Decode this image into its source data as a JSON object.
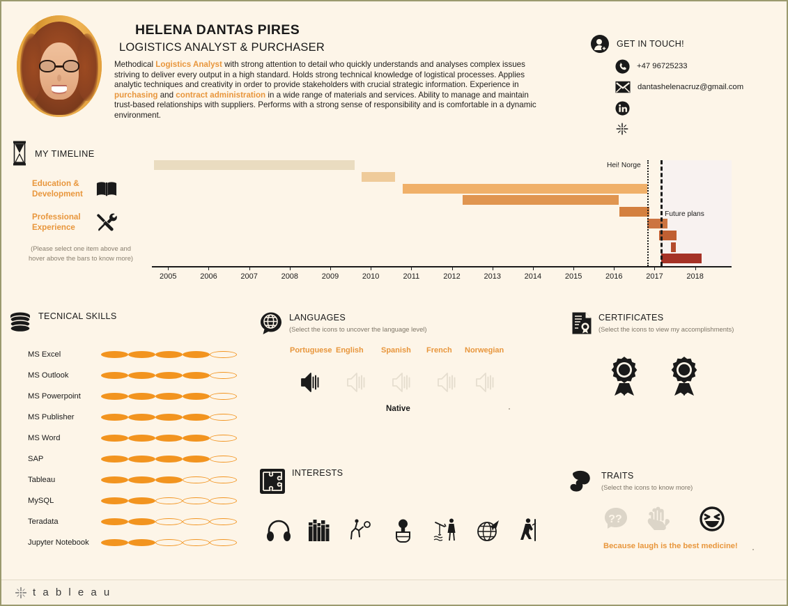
{
  "profile": {
    "name": "HELENA DANTAS PIRES",
    "role": "LOGISTICS ANALYST & PURCHASER",
    "avatar_icon": "profile-photo",
    "summary_parts": [
      {
        "t": "Methodical ",
        "hl": false
      },
      {
        "t": "Logistics Analyst",
        "hl": true
      },
      {
        "t": " with strong attention to detail who quickly understands and analyses complex issues striving to deliver every output in a high standard. Holds strong technical knowledge of logistical processes. Applies analytic techniques and creativity in order to provide stakeholders with crucial strategic information. Experience in ",
        "hl": false
      },
      {
        "t": "purchasing",
        "hl": true
      },
      {
        "t": " and ",
        "hl": false
      },
      {
        "t": "contract administration",
        "hl": true
      },
      {
        "t": " in a wide range of materials and services. Ability to manage and maintain trust-based relationships with suppliers. Performs with a strong sense of responsibility and is comfortable in a dynamic environment.",
        "hl": false
      }
    ]
  },
  "contact": {
    "title": "GET IN TOUCH!",
    "header_icon": "user-add-icon",
    "rows": [
      {
        "icon": "phone-icon",
        "text": "+47 96725233"
      },
      {
        "icon": "envelope-icon",
        "text": "dantashelenacruz@gmail.com"
      },
      {
        "icon": "linkedin-icon",
        "text": ""
      },
      {
        "icon": "tableau-icon",
        "text": ""
      }
    ]
  },
  "timeline": {
    "title": "MY TIMELINE",
    "header_icon": "hourglass-icon",
    "options": [
      {
        "label": "Education & Development",
        "icon": "open-book-icon"
      },
      {
        "label": "Professional Experience",
        "icon": "tools-icon"
      }
    ],
    "hint": "(Please select one item above and hover above the bars to know more)"
  },
  "chart_data": {
    "type": "bar",
    "chart_style": "gantt",
    "title": "My Timeline",
    "xlabel": "",
    "ylabel": "",
    "xlim": [
      2004.6,
      2018.9
    ],
    "x_ticks": [
      2005,
      2006,
      2007,
      2008,
      2009,
      2010,
      2011,
      2012,
      2013,
      2014,
      2015,
      2016,
      2017,
      2018
    ],
    "grid": false,
    "legend": "none",
    "bars": [
      {
        "row": 0,
        "start": 2004.65,
        "end": 2009.6,
        "color": "#EADCC0"
      },
      {
        "row": 1,
        "start": 2009.78,
        "end": 2010.6,
        "color": "#EFCB9A"
      },
      {
        "row": 2,
        "start": 2010.78,
        "end": 2016.82,
        "color": "#F0B069"
      },
      {
        "row": 3,
        "start": 2012.27,
        "end": 2016.12,
        "color": "#E09550"
      },
      {
        "row": 4,
        "start": 2016.13,
        "end": 2016.88,
        "color": "#D4803F"
      },
      {
        "row": 5,
        "start": 2016.82,
        "end": 2017.32,
        "color": "#CC7441"
      },
      {
        "row": 6,
        "start": 2017.12,
        "end": 2017.55,
        "color": "#C05F32"
      },
      {
        "row": 7,
        "start": 2017.4,
        "end": 2017.52,
        "color": "#B44B2C"
      },
      {
        "row": 8,
        "start": 2017.17,
        "end": 2018.16,
        "color": "#A53226"
      }
    ],
    "markers": [
      {
        "label": "Hei! Norge",
        "x": 2016.82,
        "style": "dotted"
      },
      {
        "label": "Future plans",
        "x": 2017.15,
        "style": "dashed"
      }
    ],
    "shaded_region": {
      "from": 2017.15,
      "to": 2018.9,
      "color": "#F8F2F0"
    }
  },
  "skills": {
    "title": "TECNICAL SKILLS",
    "header_icon": "database-icon",
    "max_rating": 5,
    "items": [
      {
        "name": "MS Excel",
        "rating": 4
      },
      {
        "name": "MS Outlook",
        "rating": 4
      },
      {
        "name": "MS Powerpoint",
        "rating": 4
      },
      {
        "name": "MS Publisher",
        "rating": 4
      },
      {
        "name": "MS Word",
        "rating": 4
      },
      {
        "name": "SAP",
        "rating": 4
      },
      {
        "name": "Tableau",
        "rating": 3
      },
      {
        "name": "MySQL",
        "rating": 2
      },
      {
        "name": "Teradata",
        "rating": 2
      },
      {
        "name": "Jupyter Notebook",
        "rating": 2
      }
    ]
  },
  "languages": {
    "title": "LANGUAGES",
    "header_icon": "globe-speech-icon",
    "subtitle": "(Select the icons to uncover the language level)",
    "items": [
      {
        "name": "Portuguese",
        "icon": "speaker-icon",
        "selected": true
      },
      {
        "name": "English",
        "icon": "speaker-icon",
        "selected": false
      },
      {
        "name": "Spanish",
        "icon": "speaker-icon",
        "selected": false
      },
      {
        "name": "French",
        "icon": "speaker-icon",
        "selected": false
      },
      {
        "name": "Norwegian",
        "icon": "speaker-icon",
        "selected": false
      }
    ],
    "selected_level": "Native"
  },
  "certificates": {
    "title": "CERTIFICATES",
    "header_icon": "certificate-doc-icon",
    "subtitle": "(Select the icons to view my accomplishments)",
    "items": [
      {
        "icon": "award-ribbon-icon"
      },
      {
        "icon": "award-ribbon-icon"
      }
    ]
  },
  "interests": {
    "title": "INTERESTS",
    "header_icon": "puzzle-icon",
    "items": [
      {
        "icon": "headphones-icon"
      },
      {
        "icon": "books-icon"
      },
      {
        "icon": "volleyball-icon"
      },
      {
        "icon": "cooking-icon"
      },
      {
        "icon": "fishing-icon"
      },
      {
        "icon": "travel-globe-icon"
      },
      {
        "icon": "hiking-icon"
      }
    ]
  },
  "traits": {
    "title": "TRAITS",
    "header_icon": "muscle-arm-icon",
    "subtitle": "(Select the icons to know more)",
    "items": [
      {
        "icon": "thinking-head-icon",
        "selected": false
      },
      {
        "icon": "helping-hands-icon",
        "selected": false
      },
      {
        "icon": "smiley-laugh-icon",
        "selected": true
      }
    ],
    "caption": "Because laugh is the best medicine!"
  },
  "footer": {
    "brand": "t a b l e a u",
    "brand_icon": "tableau-logo-icon"
  },
  "colors": {
    "bg": "#FDF5E8",
    "accent": "#E8963C",
    "dot": "#F2941F",
    "text": "#1A1A1A"
  }
}
